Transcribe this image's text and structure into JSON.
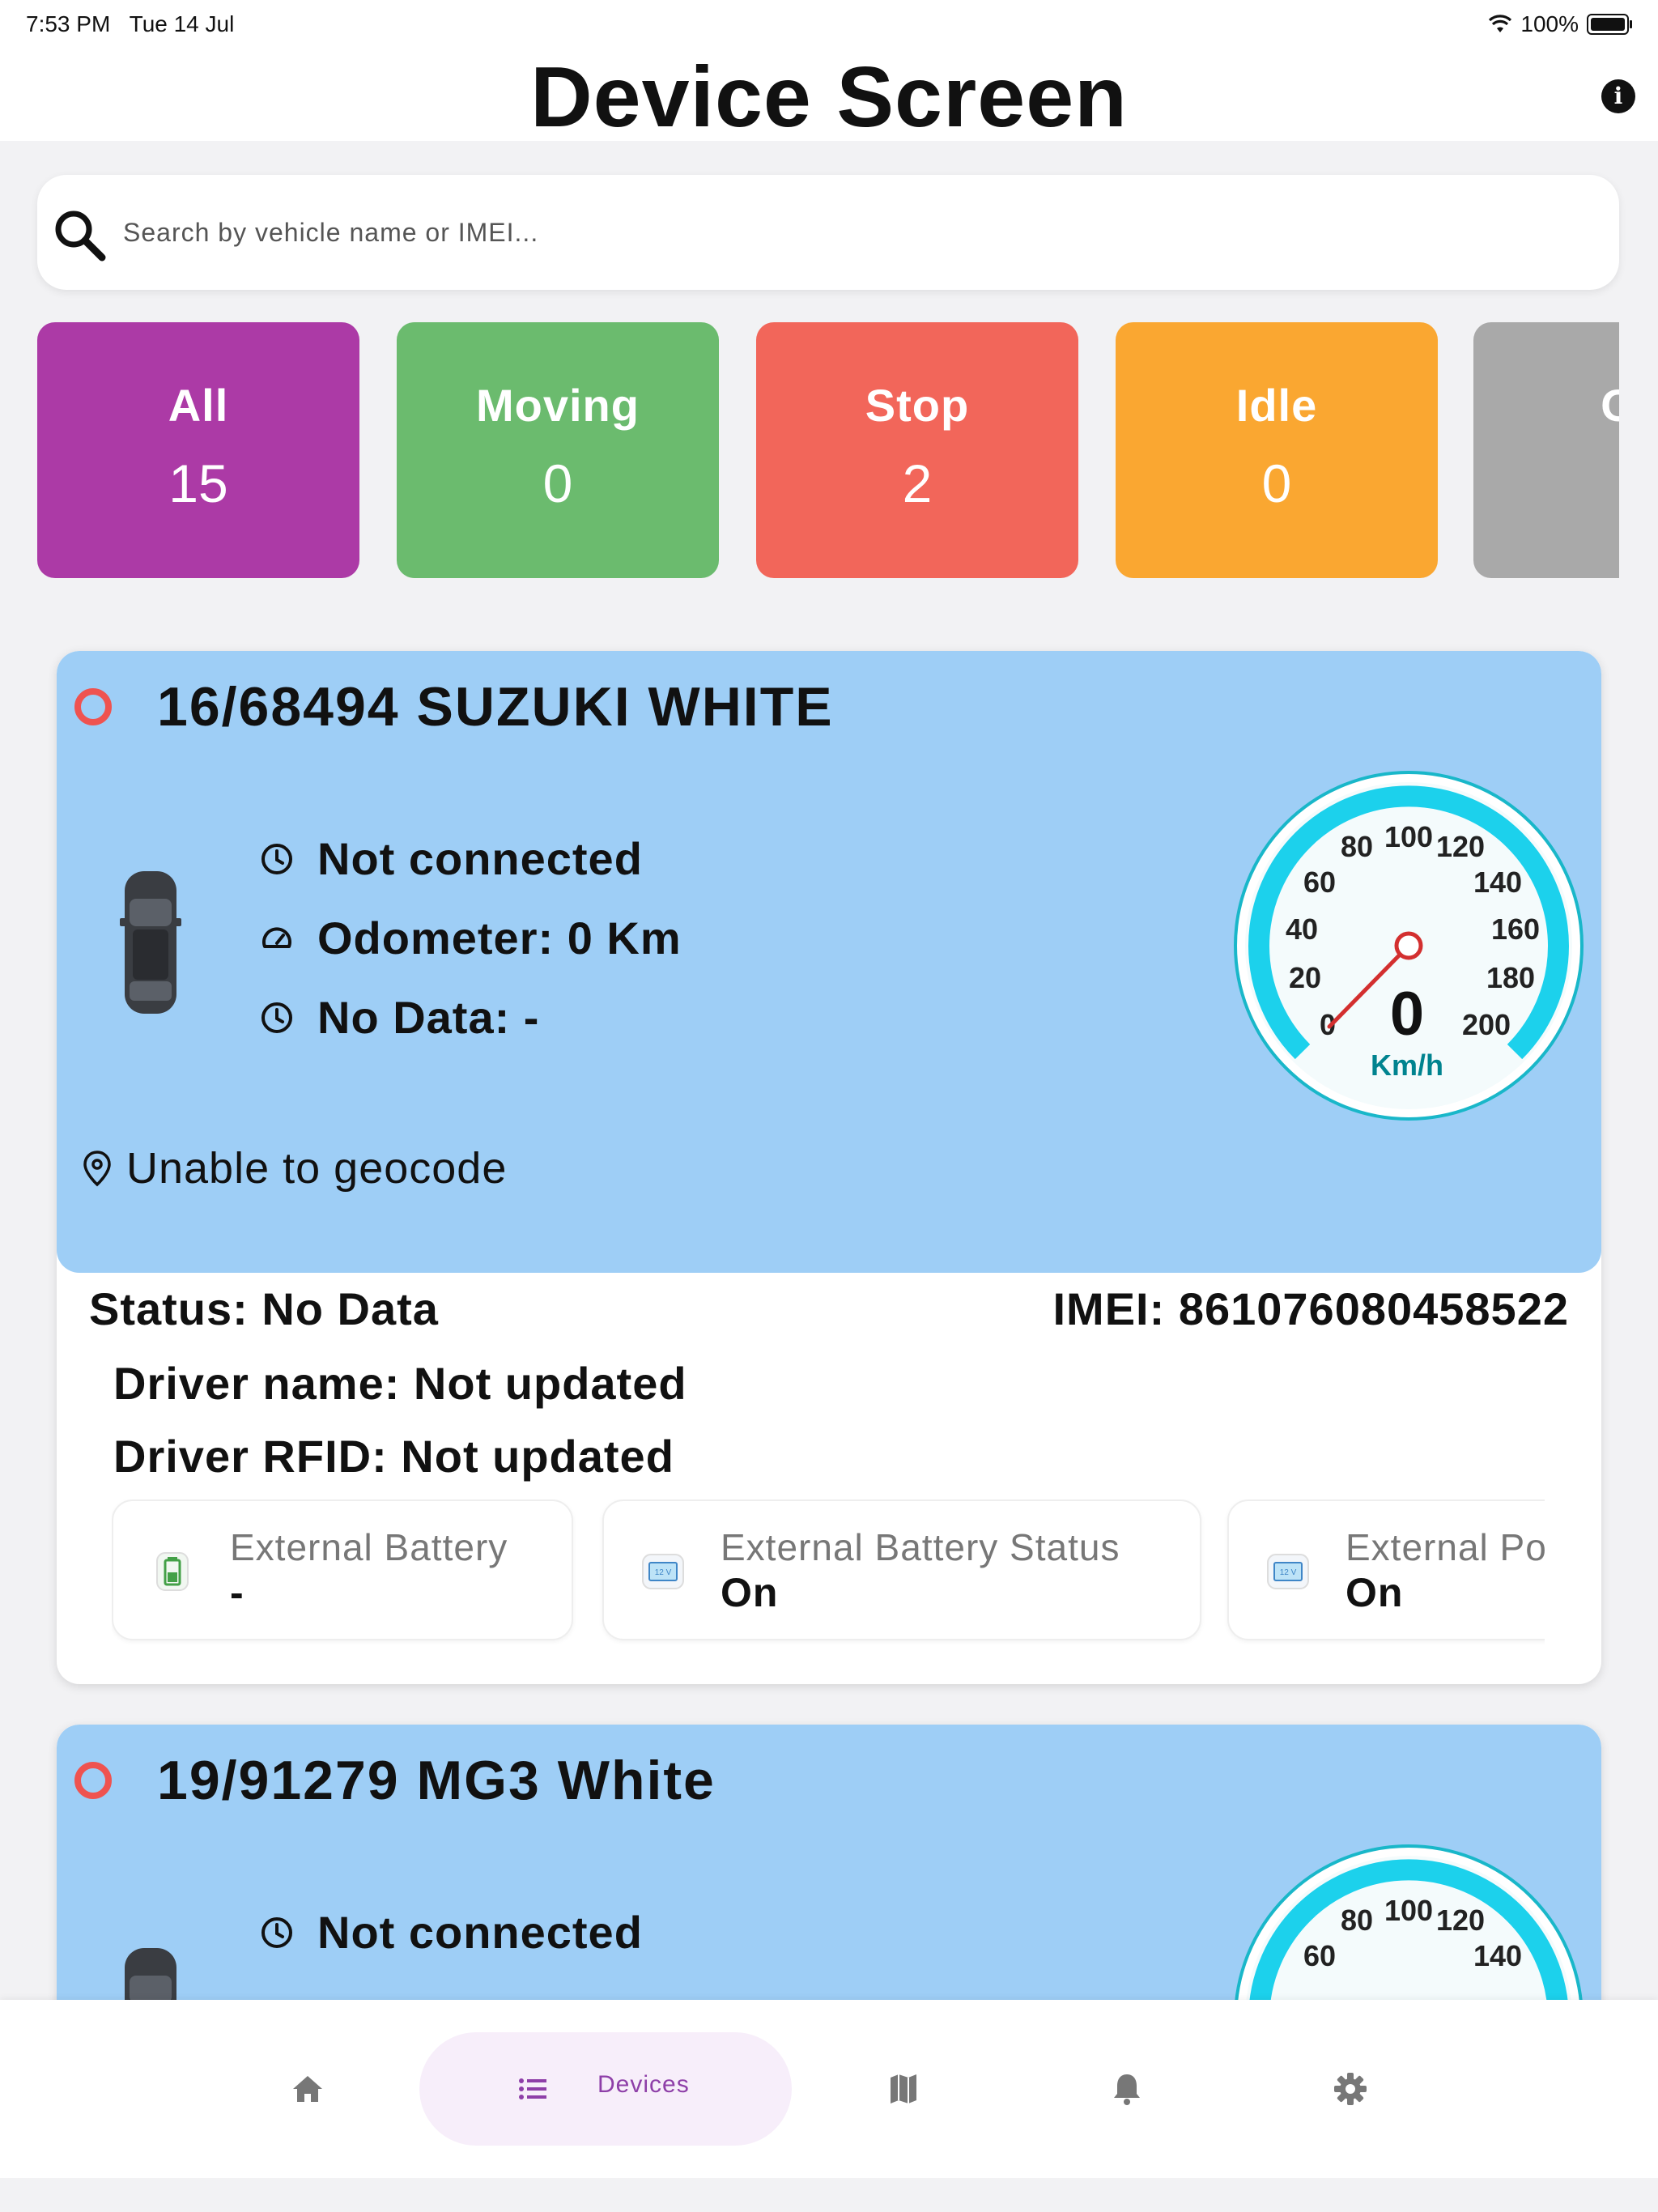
{
  "status_bar": {
    "time": "7:53 PM",
    "date": "Tue 14 Jul",
    "battery": "100%"
  },
  "header": {
    "title": "Device Screen",
    "info_icon": "info-icon"
  },
  "search": {
    "placeholder": "Search by vehicle name or IMEI..."
  },
  "filters": [
    {
      "label": "All",
      "count": "15",
      "color": "#ac3aa6"
    },
    {
      "label": "Moving",
      "count": "0",
      "color": "#6bbb6e"
    },
    {
      "label": "Stop",
      "count": "2",
      "color": "#f2665a"
    },
    {
      "label": "Idle",
      "count": "0",
      "color": "#faa731"
    },
    {
      "label": "Off",
      "count": "",
      "color": "#a9a9a9"
    }
  ],
  "devices": [
    {
      "name": "16/68494 SUZUKI WHITE",
      "connection": "Not connected",
      "odometer": "Odometer: 0 Km",
      "no_data": "No Data: -",
      "address": "Unable to geocode",
      "speed": "0",
      "speed_unit": "Km/h",
      "status": "Status: No Data",
      "imei": "IMEI: 861076080458522",
      "driver_name": "Driver name: Not updated",
      "driver_rfid": "Driver RFID: Not updated",
      "chips": [
        {
          "label": "External Battery",
          "value": "-"
        },
        {
          "label": "External Battery Status",
          "value": "On"
        },
        {
          "label": "External Po",
          "value": "On"
        }
      ]
    },
    {
      "name": "19/91279 MG3 White",
      "connection": "Not connected",
      "speed_ticks": [
        "60",
        "80",
        "100",
        "120",
        "140"
      ]
    }
  ],
  "gauge_ticks": [
    "0",
    "20",
    "40",
    "60",
    "80",
    "100",
    "120",
    "140",
    "160",
    "180",
    "200"
  ],
  "bottom_nav": {
    "items": [
      "home-icon",
      "list-icon",
      "map-icon",
      "bell-icon",
      "gear-icon"
    ],
    "active_label": "Devices"
  }
}
